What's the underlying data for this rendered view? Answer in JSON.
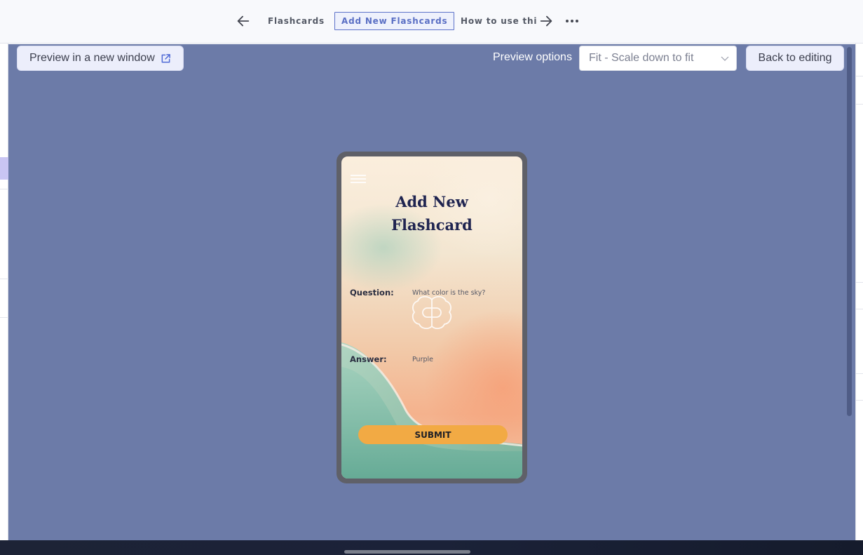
{
  "topbar": {
    "back_icon": "arrow-left-icon",
    "tabs": [
      {
        "label": "Flashcards",
        "active": false
      },
      {
        "label": "Add New Flashcards",
        "active": true
      },
      {
        "label": "How to use thi",
        "active": false
      }
    ],
    "forward_icon": "arrow-right-icon",
    "more_icon": "more-horizontal-icon"
  },
  "toolbar": {
    "preview_button_label": "Preview in a new window",
    "preview_button_icon": "external-link-icon",
    "options_label": "Preview options",
    "options_select_value": "Fit - Scale down to fit",
    "back_button_label": "Back to editing"
  },
  "app": {
    "title_line1": "Add New",
    "title_line2": "Flashcard",
    "question_label": "Question:",
    "question_value": "What color is the sky?",
    "answer_label": "Answer:",
    "answer_value": "Purple",
    "submit_label": "SUBMIT",
    "menu_icon": "hamburger-menu-icon",
    "logo_icon": "brain-icon"
  },
  "colors": {
    "preview_bg": "#6c7ba8",
    "active_tab": "#5a6fc4",
    "submit_button": "#f2aa44",
    "title_text": "#1f2450"
  }
}
